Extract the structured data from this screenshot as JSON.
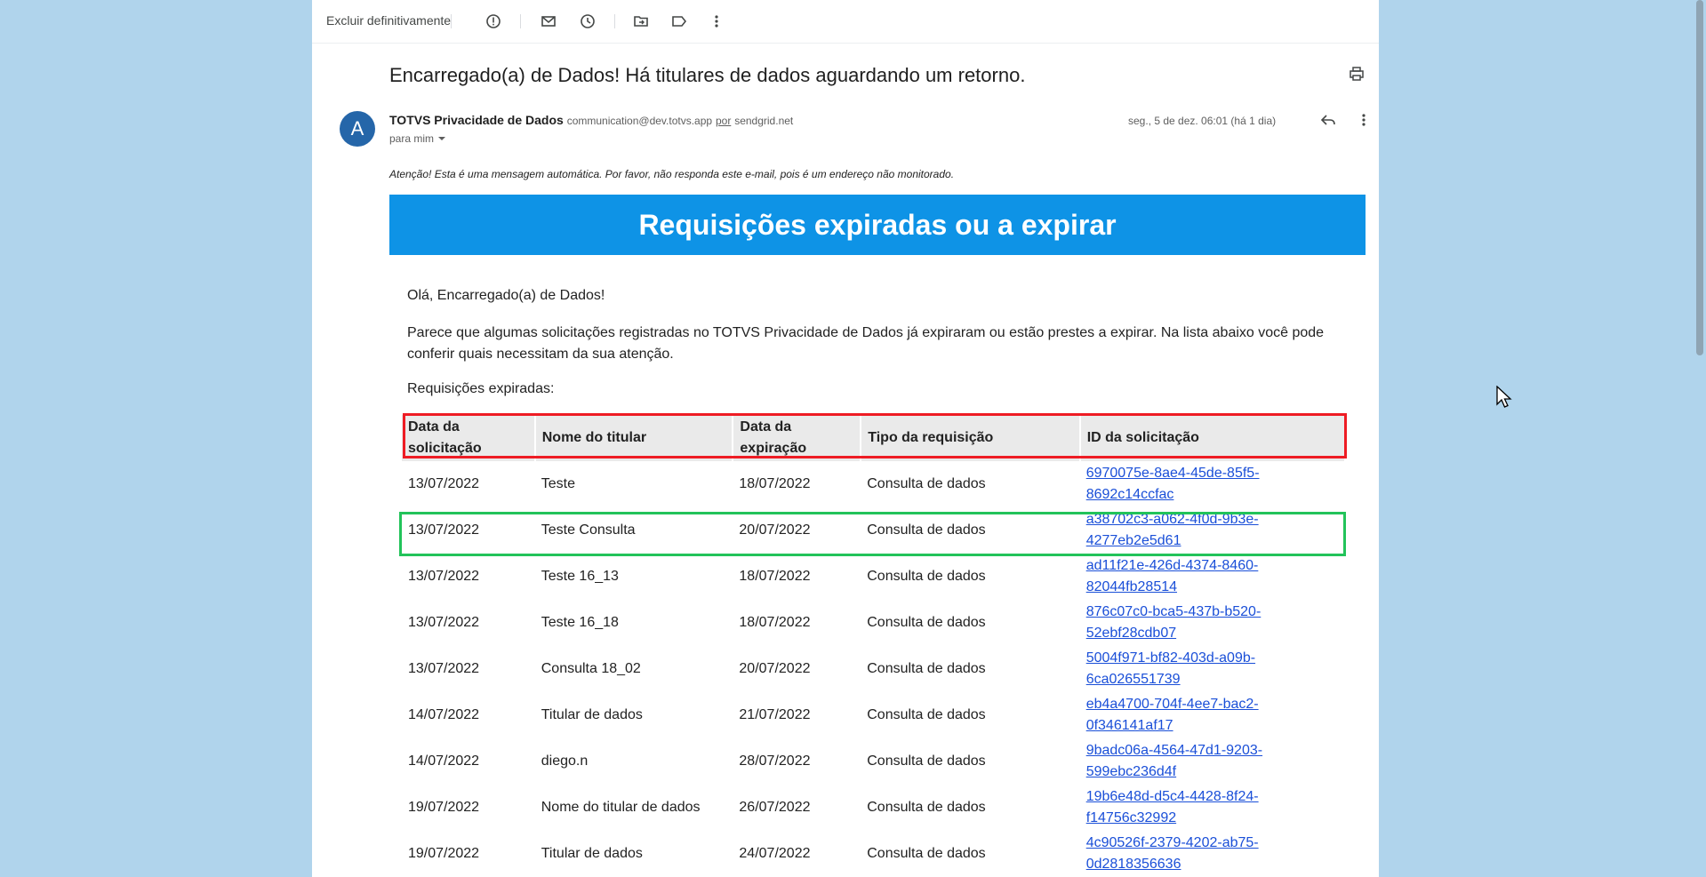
{
  "toolbar": {
    "delete_forever_label": "Excluir definitivamente",
    "icons": [
      "report-spam-icon",
      "mark-unread-icon",
      "snooze-icon",
      "move-to-icon",
      "label-icon",
      "more-vert-icon"
    ]
  },
  "email": {
    "subject": "Encarregado(a) de Dados! Há titulares de dados aguardando um retorno.",
    "avatar_letter": "A",
    "sender_name": "TOTVS Privacidade de Dados",
    "sender_email": "communication@dev.totvs.app",
    "via_label": "por",
    "via_domain": "sendgrid.net",
    "to_label": "para mim",
    "date": "seg., 5 de dez. 06:01 (há 1 dia)"
  },
  "body": {
    "notice": "Atenção! Esta é uma mensagem automática. Por favor, não responda este e-mail, pois é um endereço não monitorado.",
    "banner_title": "Requisições expiradas ou a expirar",
    "greeting": "Olá, Encarregado(a) de Dados!",
    "intro": "Parece que algumas solicitações registradas no TOTVS Privacidade de Dados já expiraram ou estão prestes a expirar. Na lista abaixo você pode conferir quais necessitam da sua atenção.",
    "section_label": "Requisições expiradas:"
  },
  "table": {
    "headers": [
      "Data da solicitação",
      "Nome do titular",
      "Data da expiração",
      "Tipo da requisição",
      "ID da solicitação"
    ],
    "rows": [
      {
        "date": "13/07/2022",
        "name": "Teste",
        "expiry": "18/07/2022",
        "type": "Consulta de dados",
        "id": "6970075e-8ae4-45de-85f5-8692c14ccfac"
      },
      {
        "date": "13/07/2022",
        "name": "Teste Consulta",
        "expiry": "20/07/2022",
        "type": "Consulta de dados",
        "id": "a38702c3-a062-4f0d-9b3e-4277eb2e5d61"
      },
      {
        "date": "13/07/2022",
        "name": "Teste 16_13",
        "expiry": "18/07/2022",
        "type": "Consulta de dados",
        "id": "ad11f21e-426d-4374-8460-82044fb28514"
      },
      {
        "date": "13/07/2022",
        "name": "Teste 16_18",
        "expiry": "18/07/2022",
        "type": "Consulta de dados",
        "id": "876c07c0-bca5-437b-b520-52ebf28cdb07"
      },
      {
        "date": "13/07/2022",
        "name": "Consulta 18_02",
        "expiry": "20/07/2022",
        "type": "Consulta de dados",
        "id": "5004f971-bf82-403d-a09b-6ca026551739"
      },
      {
        "date": "14/07/2022",
        "name": "Titular de dados",
        "expiry": "21/07/2022",
        "type": "Consulta de dados",
        "id": "eb4a4700-704f-4ee7-bac2-0f346141af17"
      },
      {
        "date": "14/07/2022",
        "name": "diego.n",
        "expiry": "28/07/2022",
        "type": "Consulta de dados",
        "id": "9badc06a-4564-47d1-9203-599ebc236d4f"
      },
      {
        "date": "19/07/2022",
        "name": "Nome do titular de dados",
        "expiry": "26/07/2022",
        "type": "Consulta de dados",
        "id": "19b6e48d-d5c4-4428-8f24-f14756c32992"
      },
      {
        "date": "19/07/2022",
        "name": "Titular de dados",
        "expiry": "24/07/2022",
        "type": "Consulta de dados",
        "id": "4c90526f-2379-4202-ab75-0d2818356636"
      }
    ]
  },
  "colors": {
    "background": "#b0d4ec",
    "banner": "#0e93e6",
    "avatar": "#2566a9",
    "link": "#1a4fd8",
    "highlight_header": "#ee1c24",
    "highlight_row": "#22c35a"
  }
}
